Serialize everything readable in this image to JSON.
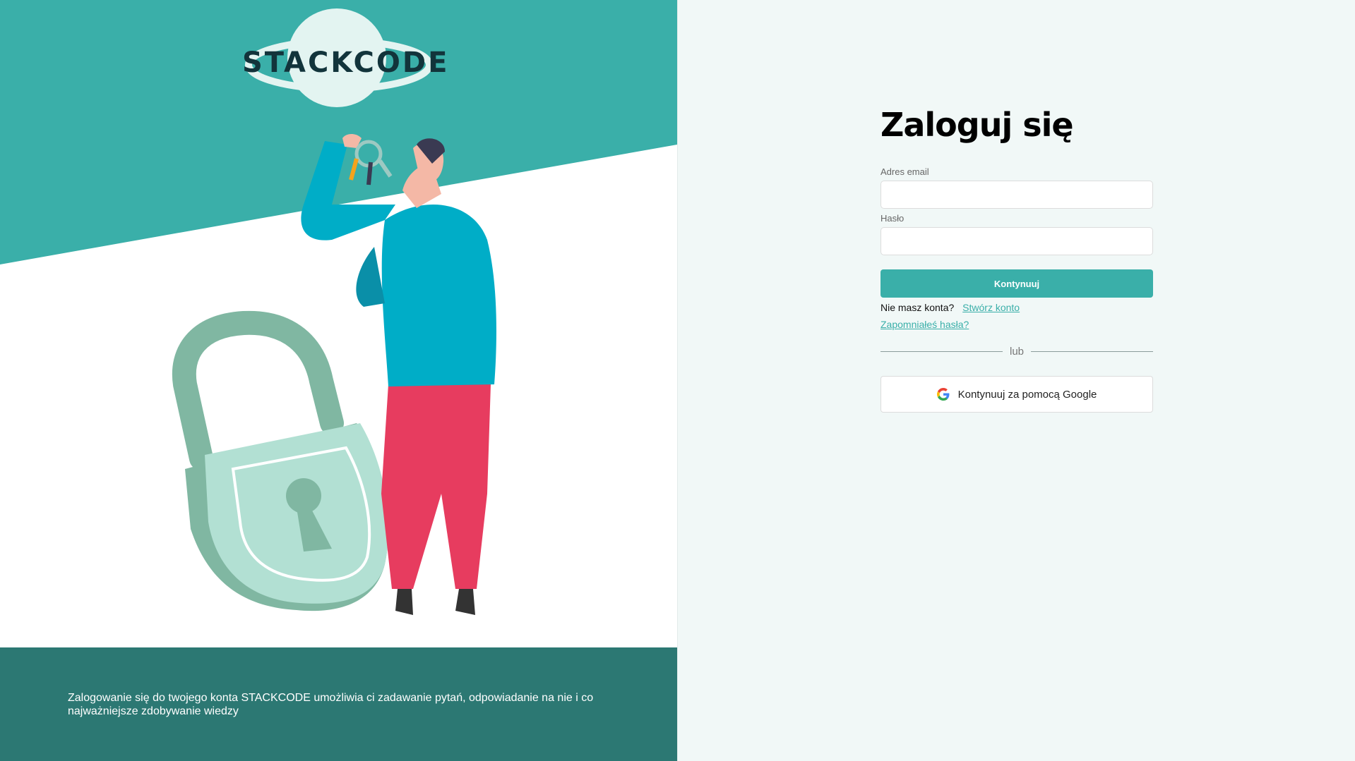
{
  "brand": {
    "logo_text": "STACKCODE",
    "accent": "#3aafa9",
    "dark_teal": "#2c7873"
  },
  "left_panel": {
    "footer_text": "Zalogowanie się do twojego konta STACKCODE umożliwia ci zadawanie pytań, odpowiadanie na nie i co najważniejsze zdobywanie wiedzy"
  },
  "login": {
    "title": "Zaloguj się",
    "email_label": "Adres email",
    "email_value": "",
    "password_label": "Hasło",
    "password_value": "",
    "continue_label": "Kontynuuj",
    "no_account_text": "Nie masz konta?",
    "create_account_link": "Stwórz konto",
    "forgot_password_link": "Zapomniałeś hasła?",
    "divider_text": "lub",
    "google_button_label": "Kontynuuj za pomocą Google",
    "google_icon": "google-g-icon"
  }
}
